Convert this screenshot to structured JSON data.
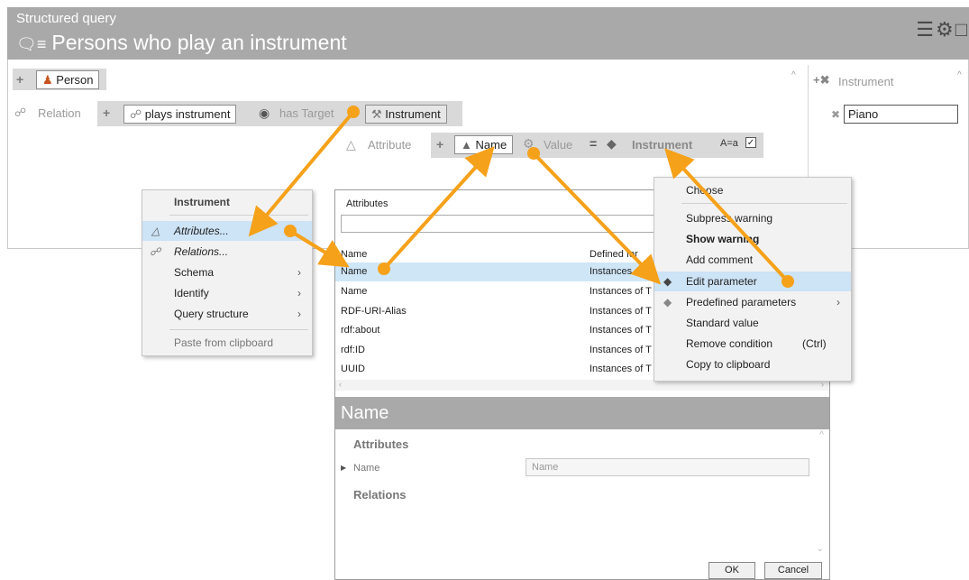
{
  "header": {
    "subtitle": "Structured query",
    "title": "Persons who play an instrument",
    "title_icon": "query-icon"
  },
  "query": {
    "person_label": "Person",
    "relation_label": "Relation",
    "plays_instrument": "plays instrument",
    "has_target": "has Target",
    "instrument_chip": "Instrument",
    "attribute_label": "Attribute",
    "name_chip": "Name",
    "value_label": "Value",
    "equals": "=",
    "instrument_value": "Instrument",
    "case_toggle": "A=a"
  },
  "right_panel": {
    "instrument_label": "Instrument",
    "piano_value": "Piano"
  },
  "context_menu": {
    "header": "Instrument",
    "items": [
      {
        "label": "Attributes...",
        "icon": "triangle-icon"
      },
      {
        "label": "Relations...",
        "icon": "relation-icon"
      },
      {
        "label": "Schema"
      },
      {
        "label": "Identify"
      },
      {
        "label": "Query structure"
      },
      {
        "label": "Paste from clipboard"
      }
    ]
  },
  "value_menu": {
    "items": [
      {
        "label": "Choose"
      },
      {
        "label": "Subpress warning"
      },
      {
        "label": "Show warning"
      },
      {
        "label": "Add comment"
      },
      {
        "label": "Edit parameter"
      },
      {
        "label": "Predefined parameters"
      },
      {
        "label": "Standard value"
      },
      {
        "label": "Remove condition",
        "shortcut": "(Ctrl)"
      },
      {
        "label": "Copy to clipboard"
      }
    ]
  },
  "dialog": {
    "title": "Attributes",
    "columns": [
      "Name",
      "Defined for"
    ],
    "rows": [
      {
        "name": "Name",
        "defined": "Instances of T"
      },
      {
        "name": "Name",
        "defined": "Instances of T"
      },
      {
        "name": "RDF-URI-Alias",
        "defined": "Instances of T"
      },
      {
        "name": "rdf:about",
        "defined": "Instances of T"
      },
      {
        "name": "rdf:ID",
        "defined": "Instances of T"
      },
      {
        "name": "UUID",
        "defined": "Instances of T"
      }
    ],
    "detail_title": "Name",
    "section_attributes": "Attributes",
    "field_label": "Name",
    "field_value": "Name",
    "section_relations": "Relations",
    "ok": "OK",
    "cancel": "Cancel"
  },
  "colors": {
    "header_bg": "#a9a9a9",
    "arrow": "#f5a11a",
    "highlight": "#cde3f6"
  }
}
